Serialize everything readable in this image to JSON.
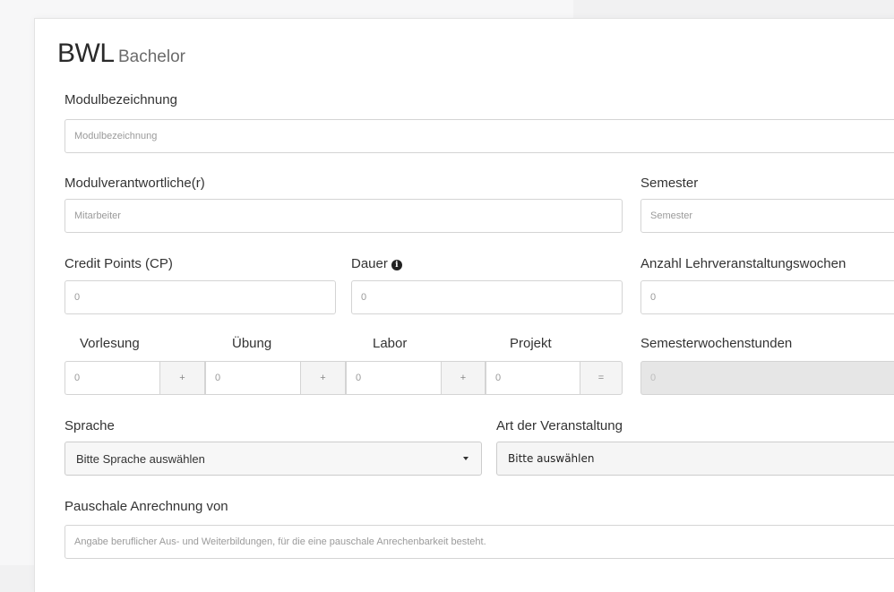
{
  "page": {
    "title": "BWL",
    "subtitle": "Bachelor"
  },
  "form": {
    "modulbezeichnung": {
      "label": "Modulbezeichnung",
      "placeholder": "Modulbezeichnung"
    },
    "modulverantwortliche": {
      "label": "Modulverantwortliche(r)",
      "placeholder": "Mitarbeiter"
    },
    "semester": {
      "label": "Semester",
      "placeholder": "Semester"
    },
    "credit_points": {
      "label": "Credit Points (CP)",
      "placeholder": "0"
    },
    "dauer": {
      "label": "Dauer",
      "info_icon": "i",
      "placeholder": "0"
    },
    "lehrveranstaltungswochen": {
      "label": "Anzahl Lehrveranstaltungswochen",
      "placeholder": "0"
    },
    "hours": {
      "vorlesung": {
        "label": "Vorlesung",
        "value": "0",
        "addon": "+"
      },
      "uebung": {
        "label": "Übung",
        "value": "0",
        "addon": "+"
      },
      "labor": {
        "label": "Labor",
        "value": "0",
        "addon": "+"
      },
      "projekt": {
        "label": "Projekt",
        "value": "0",
        "addon": "="
      },
      "semesterwochenstunden": {
        "label": "Semesterwochenstunden",
        "value": "0"
      }
    },
    "sprache": {
      "label": "Sprache",
      "selected": "Bitte Sprache auswählen"
    },
    "art": {
      "label": "Art der Veranstaltung",
      "selected": "Bitte auswählen"
    },
    "pauschale": {
      "label": "Pauschale Anrechnung von",
      "placeholder": "Angabe beruflicher Aus- und Weiterbildungen, für die eine pauschale Anrechenbarkeit besteht."
    }
  }
}
